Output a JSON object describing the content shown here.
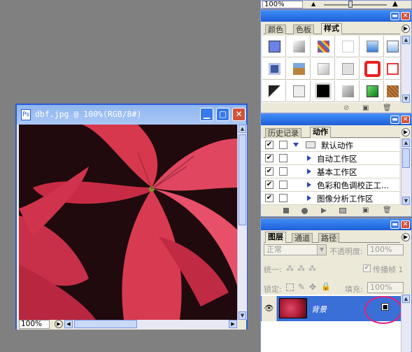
{
  "top_toolbar": {
    "zoom_value": "100%"
  },
  "styles_panel": {
    "tabs": [
      "颜色",
      "色板",
      "样式"
    ],
    "active_tab": "样式",
    "swatches": [
      {
        "name": "default-blue",
        "color": "#6b82e8"
      },
      {
        "name": "gray-bevel",
        "color": "#b0b0b0"
      },
      {
        "name": "mosaic",
        "color": "#6a7fa8"
      },
      {
        "name": "white",
        "color": "#ffffff"
      },
      {
        "name": "blue-glass",
        "color": "#4a8ee0"
      },
      {
        "name": "light-blue",
        "color": "#9ac0ec"
      },
      {
        "name": "frame-blue",
        "color": "#3f56a0"
      },
      {
        "name": "landscape",
        "color": "#b8843c"
      },
      {
        "name": "light-gray",
        "color": "#d8d8d8"
      },
      {
        "name": "pale-gray",
        "color": "#e0e0e0"
      },
      {
        "name": "red-ring",
        "color": "#e82020"
      },
      {
        "name": "red-outline",
        "color": "#e83a3a"
      },
      {
        "name": "black-corner",
        "color": "#222222"
      },
      {
        "name": "gray-square",
        "color": "#dddddd"
      },
      {
        "name": "black-box",
        "color": "#000000"
      },
      {
        "name": "steel",
        "color": "#9a9a9a"
      },
      {
        "name": "green",
        "color": "#1c9a28"
      },
      {
        "name": "brown-texture",
        "color": "#9a5a28"
      }
    ]
  },
  "actions_panel": {
    "tabs": [
      "历史记录",
      "动作"
    ],
    "active_tab": "动作",
    "items": [
      {
        "label": "默认动作",
        "type": "folder"
      },
      {
        "label": "自动工作区",
        "type": "action"
      },
      {
        "label": "基本工作区",
        "type": "action"
      },
      {
        "label": "色彩和色调校正工...",
        "type": "action"
      },
      {
        "label": "图像分析工作区",
        "type": "action"
      }
    ]
  },
  "layers_panel": {
    "tabs": [
      "图层",
      "通道",
      "路径"
    ],
    "active_tab": "图层",
    "blend_mode": "正常",
    "opacity_label": "不透明度:",
    "opacity_value": "100%",
    "unify_label": "统一:",
    "propagate_label": "传播帧 1",
    "lock_label": "锁定:",
    "fill_label": "填充:",
    "fill_value": "100%",
    "layer_name": "背景"
  },
  "document": {
    "title": "dbf.jpg @ 100%(RGB/8#)",
    "zoom": "100%"
  }
}
